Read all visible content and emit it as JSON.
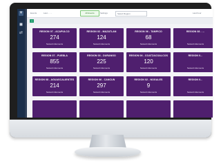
{
  "topbar": {
    "nav_text": "Events",
    "crumb_text": "Last ... ...",
    "filter_pill": "All Events",
    "setting_label": "Settings",
    "select_value": "Select Region",
    "right_text": "Last hour"
  },
  "filter": {
    "button_label": "+"
  },
  "tiles": [
    {
      "name": "REGION 07 - ACAPULCO",
      "count": "274",
      "sub": "Network Elements"
    },
    {
      "name": "REGION 02 - MAZATLAN",
      "count": "124",
      "sub": "Network Elements"
    },
    {
      "name": "REGION 06 - TAMPICO",
      "count": "68",
      "sub": "Network Elements"
    },
    {
      "name": "REGION 08 - ...",
      "count": "",
      "sub": "Network Elements"
    },
    {
      "name": "REGION 07 - PUEBLA",
      "count": "855",
      "sub": "Network Elements"
    },
    {
      "name": "REGION 03 - DURANGO",
      "count": "225",
      "sub": "Network Elements"
    },
    {
      "name": "REGION 06 - COATZACOALCOS",
      "count": "120",
      "sub": "Network Elements"
    },
    {
      "name": "REGION 0...",
      "count": "",
      "sub": "Network Elements"
    },
    {
      "name": "REGION 08 - AGUASCALIENTES",
      "count": "214",
      "sub": "Network Elements"
    },
    {
      "name": "REGION 06 - CANCUN",
      "count": "297",
      "sub": "Network Elements"
    },
    {
      "name": "REGION 02 - NOGALES",
      "count": "9",
      "sub": "Network Elements"
    },
    {
      "name": "REGION 0...",
      "count": "",
      "sub": "Network Elements"
    },
    {
      "name": "",
      "count": "",
      "sub": ""
    },
    {
      "name": "",
      "count": "",
      "sub": ""
    },
    {
      "name": "",
      "count": "",
      "sub": ""
    },
    {
      "name": "",
      "count": "",
      "sub": ""
    }
  ]
}
